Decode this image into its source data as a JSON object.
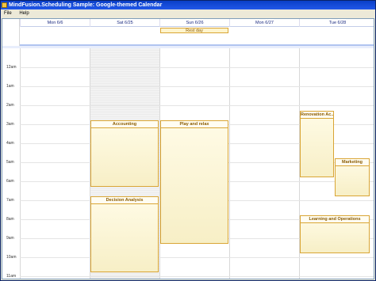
{
  "window": {
    "title": "MindFusion.Scheduling Sample: Google-themed Calendar"
  },
  "menu": {
    "file": "File",
    "help": "Help"
  },
  "days": [
    {
      "label": "Mon 6/6"
    },
    {
      "label": "Sat 6/25"
    },
    {
      "label": "Sun 6/26"
    },
    {
      "label": "Mon 6/27"
    },
    {
      "label": "Tue 6/28"
    }
  ],
  "hours": [
    "12am",
    "1am",
    "2am",
    "3am",
    "4am",
    "5am",
    "6am",
    "7am",
    "8am",
    "9am",
    "10am",
    "11am"
  ],
  "allday_events": [
    {
      "title": "Rest day",
      "day": "Sun 6/26"
    }
  ],
  "events": [
    {
      "title": "Accounting",
      "day": "Sat 6/25"
    },
    {
      "title": "Decision Analysis",
      "day": "Sat 6/25"
    },
    {
      "title": "Play and relax",
      "day": "Sun 6/26"
    },
    {
      "title": "Renovation Ac...",
      "day": "Tue 6/28"
    },
    {
      "title": "Marketing",
      "day": "Tue 6/28"
    },
    {
      "title": "Learning and Operations",
      "day": "Tue 6/28"
    }
  ],
  "colors": {
    "title_bar": "#0a3fc8",
    "event_border": "#d9a535",
    "event_fill": "#f7efc6",
    "header_text": "#1a2a80"
  }
}
